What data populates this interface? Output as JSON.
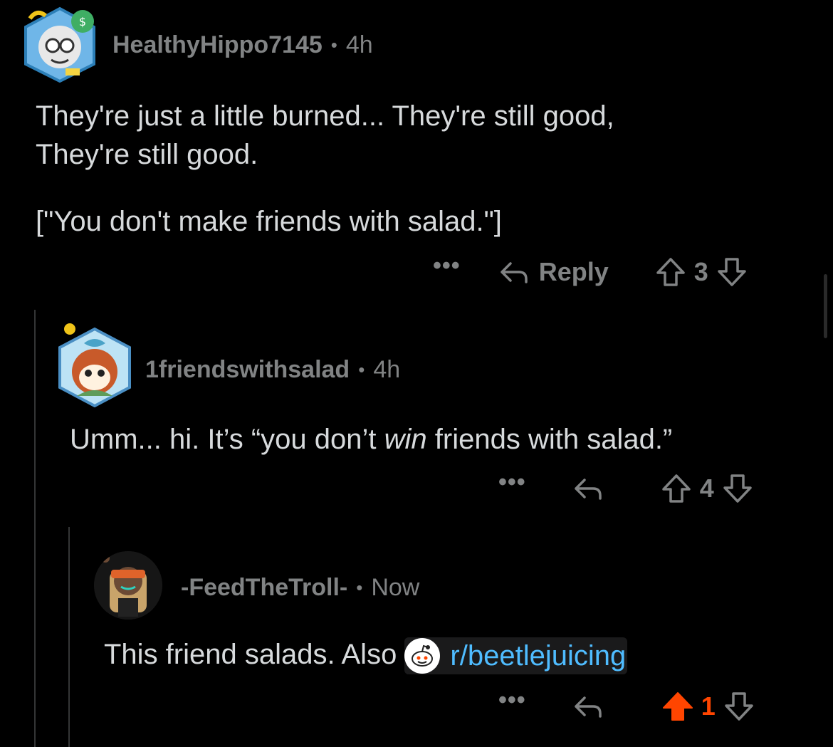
{
  "comments": [
    {
      "username": "HealthyHippo7145",
      "age": "4h",
      "paragraphs": [
        "They're just a little burned... They're still good,",
        "They're still good.",
        "[\"You don't make friends with salad.\"]"
      ],
      "more_label": "•••",
      "reply_label": "Reply",
      "score": "3"
    },
    {
      "username": "1friendswithsalad",
      "age": "4h",
      "text_before": "Umm... hi. It’s “you don’t ",
      "text_emphasis": "win",
      "text_after": " friends with salad.”",
      "more_label": "•••",
      "score": "4"
    },
    {
      "username": "-FeedTheTroll-",
      "age": "Now",
      "text_before": "This friend salads. Also ",
      "link_text": "r/beetlejuicing",
      "more_label": "•••",
      "score": "1",
      "upvoted": true
    }
  ],
  "colors": {
    "background": "#000000",
    "text": "#d7dadc",
    "muted": "#818384",
    "link": "#4fbcff",
    "upvote": "#ff4500",
    "thread_line": "#343536"
  },
  "icons": {
    "reply": "reply-arrow-icon",
    "upvote": "upvote-arrow-icon",
    "downvote": "downvote-arrow-icon",
    "more": "more-dots-icon",
    "subreddit": "reddit-snoo-icon"
  }
}
